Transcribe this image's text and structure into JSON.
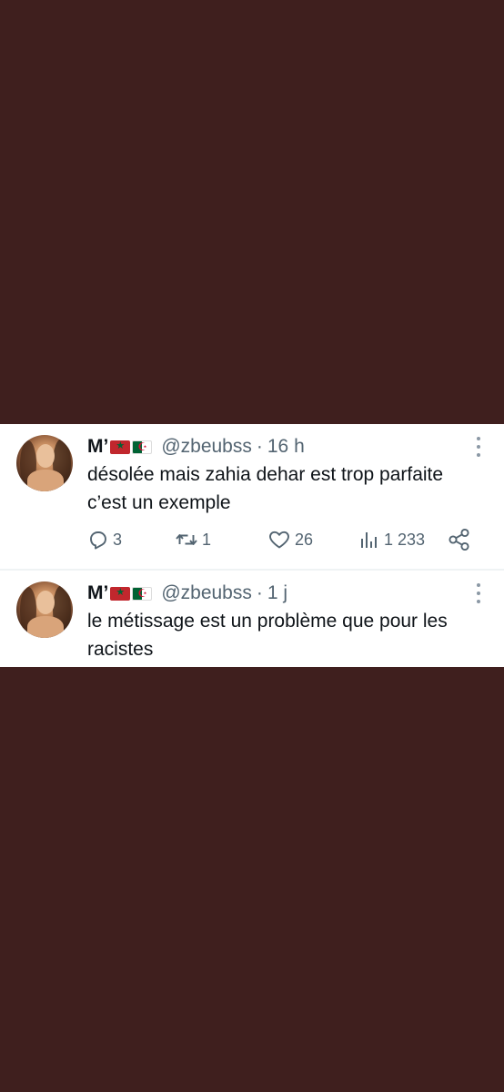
{
  "tweets": [
    {
      "display_name": "M’",
      "handle": "@zbeubss",
      "separator": "·",
      "time": "16 h",
      "text": "désolée mais zahia dehar est trop parfaite c’est un exemple",
      "flags": [
        "morocco-flag",
        "algeria-flag"
      ],
      "actions": {
        "replies": "3",
        "retweets": "1",
        "likes": "26",
        "views": "1 233"
      }
    },
    {
      "display_name": "M’",
      "handle": "@zbeubss",
      "separator": "·",
      "time": "1 j",
      "text": "le métissage est un problème que pour les racistes",
      "flags": [
        "morocco-flag",
        "algeria-flag"
      ]
    }
  ],
  "colors": {
    "background": "#3f1f1e",
    "card": "#ffffff",
    "text_primary": "#0f1419",
    "text_secondary": "#536471"
  }
}
